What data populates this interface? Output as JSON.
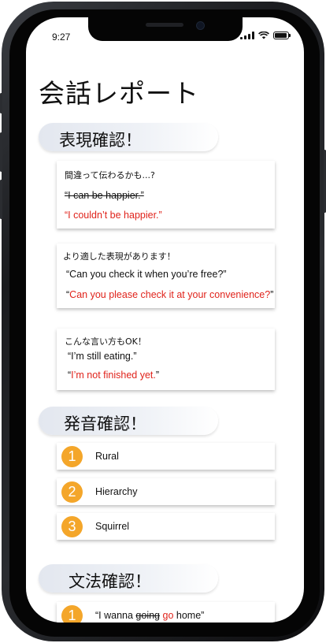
{
  "status": {
    "time": "9:27"
  },
  "page": {
    "title": "会話レポート"
  },
  "sections": {
    "expression": {
      "title": "表現確認！",
      "cards": [
        {
          "note": "間違って伝わるかも...?",
          "original": "“I can be happier.”",
          "correction": "“I couldn’t be happier.”"
        },
        {
          "note": "より適した表現があります！",
          "original": "“Can you check it when you’re free?”",
          "correction_prefix": "“",
          "correction_red": "Can you please check it at your convenience?",
          "correction_suffix": "”"
        },
        {
          "note": "こんな言い方もOK！",
          "original": "“I’m still eating.”",
          "correction_prefix": "“",
          "correction_red": "I’m not finished yet.",
          "correction_suffix": "”"
        }
      ]
    },
    "pronunciation": {
      "title": "発音確認！",
      "items": [
        {
          "number": "1",
          "word": "Rural"
        },
        {
          "number": "2",
          "word": "Hierarchy"
        },
        {
          "number": "3",
          "word": "Squirrel"
        }
      ]
    },
    "grammar": {
      "title": "文法確認！",
      "items": [
        {
          "number": "1",
          "text_before": "“I wanna ",
          "text_struck": "going",
          "text_space": " ",
          "text_red": "go",
          "text_after": " home”"
        }
      ]
    }
  },
  "colors": {
    "accent_red": "#e0231b",
    "badge_orange": "#f4a62a"
  }
}
